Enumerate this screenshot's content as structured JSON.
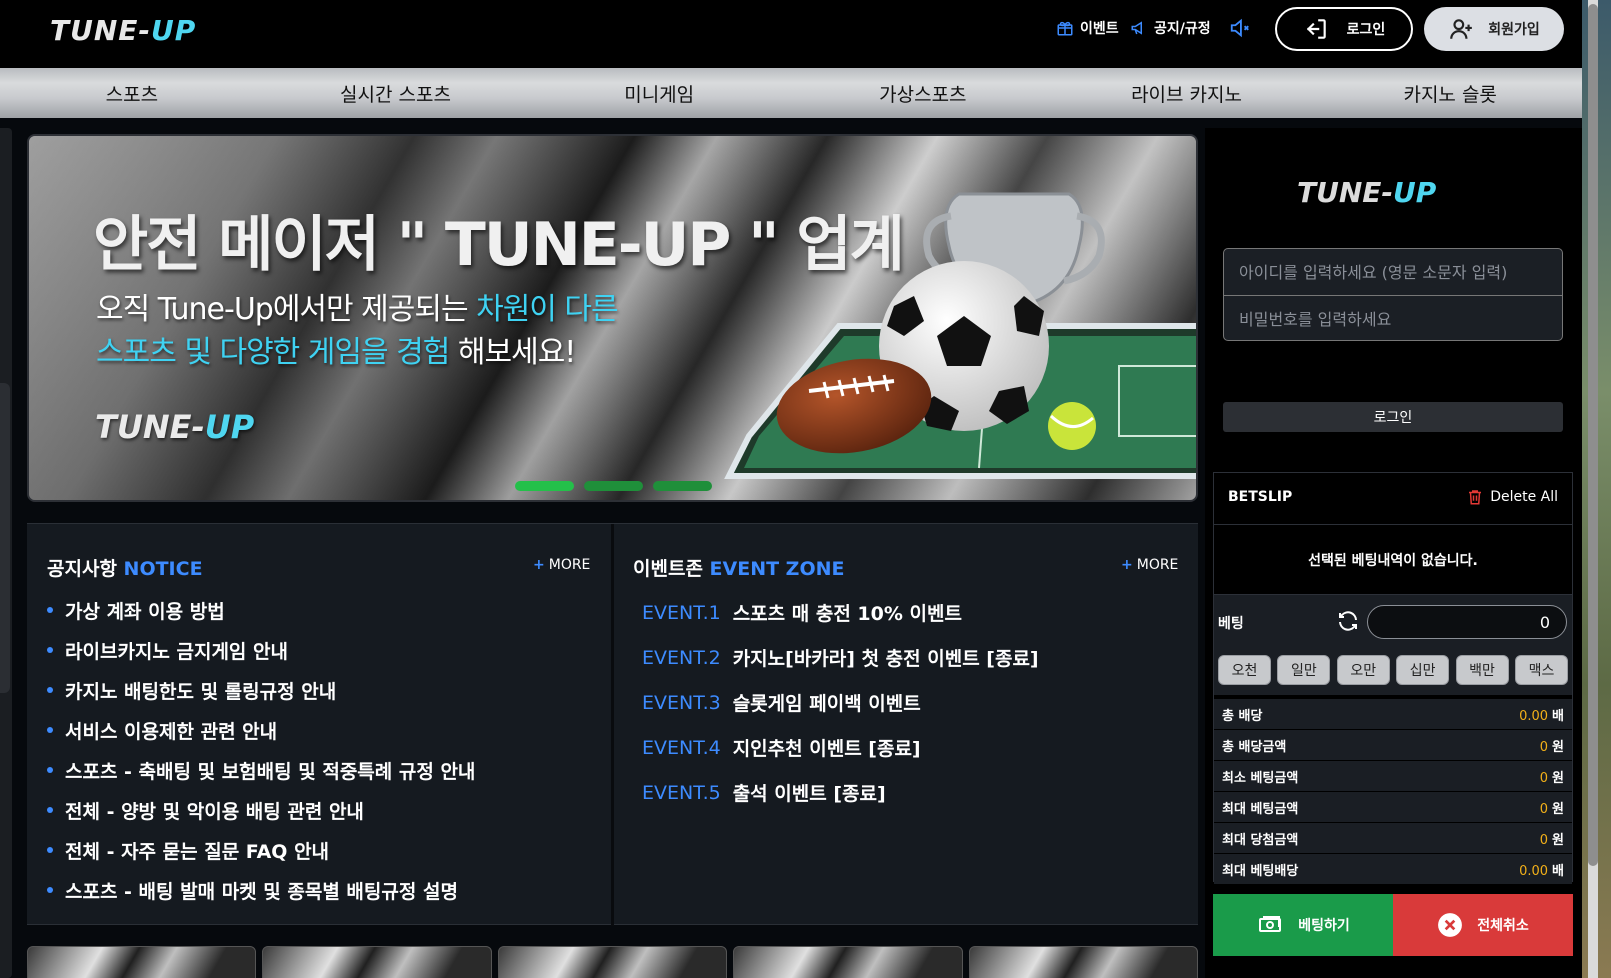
{
  "header": {
    "logo_main": "TUNE-",
    "logo_accent": "UP",
    "links": [
      {
        "label": "이벤트",
        "icon": "gift-icon"
      },
      {
        "label": "공지/규정",
        "icon": "megaphone-icon"
      }
    ],
    "mute_icon": "speaker-muted-icon",
    "login_label": "로그인",
    "join_label": "회원가입"
  },
  "nav": {
    "items": [
      "스포츠",
      "실시간 스포츠",
      "미니게임",
      "가상스포츠",
      "라이브 카지노",
      "카지노 슬롯"
    ]
  },
  "banner": {
    "title": "안전 메이저 \" TUNE-UP \" 업계",
    "sub_line1_a": "오직 Tune-Up에서만 제공되는 ",
    "sub_line1_hl": "차원이 다른",
    "sub_line2_hl": "스포츠 및 다양한 게임을 경험",
    "sub_line2_b": " 해보세요!",
    "logo_main": "TUNE-",
    "logo_accent": "UP",
    "slide_count": 3,
    "active_slide": 1
  },
  "notice": {
    "title_ko": "공지사항 ",
    "title_en": "NOTICE",
    "more": "MORE",
    "items": [
      "가상 계좌 이용 방법",
      "라이브카지노 금지게임 안내",
      "카지노 배팅한도 및 롤링규정 안내",
      "서비스 이용제한 관련 안내",
      "스포츠 - 축배팅 및 보험배팅 및 적중특례 규정 안내",
      "전체 - 양방 및 악이용 배팅 관련 안내",
      "전체 - 자주 묻는 질문 FAQ 안내",
      "스포츠 - 배팅 발매 마켓 및 종목별 배팅규정 설명"
    ]
  },
  "events": {
    "title_ko": "이벤트존 ",
    "title_en": "EVENT ZONE",
    "more": "MORE",
    "items": [
      {
        "tag": "EVENT.1",
        "text": "스포츠 매 충전 10% 이벤트"
      },
      {
        "tag": "EVENT.2",
        "text": "카지노[바카라] 첫 충전 이벤트 [종료]"
      },
      {
        "tag": "EVENT.3",
        "text": "슬롯게임 페이백 이벤트"
      },
      {
        "tag": "EVENT.4",
        "text": "지인추천 이벤트 [종료]"
      },
      {
        "tag": "EVENT.5",
        "text": "출석 이벤트 [종료]"
      }
    ]
  },
  "side": {
    "logo_main": "TUNE-",
    "logo_accent": "UP",
    "id_placeholder": "아이디를 입력하세요 (영문 소문자 입력)",
    "pw_placeholder": "비밀번호를 입력하세요",
    "login_label": "로그인"
  },
  "betslip": {
    "title": "BETSLIP",
    "delete_all": "Delete All",
    "empty_msg": "선택된 베팅내역이 없습니다.",
    "bet_label": "베팅",
    "bet_value": "0",
    "chips": [
      "오천",
      "일만",
      "오만",
      "십만",
      "백만",
      "맥스"
    ],
    "rows": [
      {
        "label": "총 배당",
        "value": "0.00",
        "unit": "배"
      },
      {
        "label": "총 배당금액",
        "value": "0",
        "unit": "원"
      },
      {
        "label": "최소 베팅금액",
        "value": "0",
        "unit": "원"
      },
      {
        "label": "최대 베팅금액",
        "value": "0",
        "unit": "원"
      },
      {
        "label": "최대 당첨금액",
        "value": "0",
        "unit": "원"
      },
      {
        "label": "최대 베팅배당",
        "value": "0.00",
        "unit": "배"
      }
    ],
    "bet_button": "베팅하기",
    "cancel_button": "전체취소"
  },
  "colors": {
    "accent_blue": "#3d8bff",
    "accent_cyan": "#3fd2f2",
    "bet_green": "#1a9b4a",
    "cancel_red": "#d93a3a",
    "value_gold": "#f2b019"
  }
}
